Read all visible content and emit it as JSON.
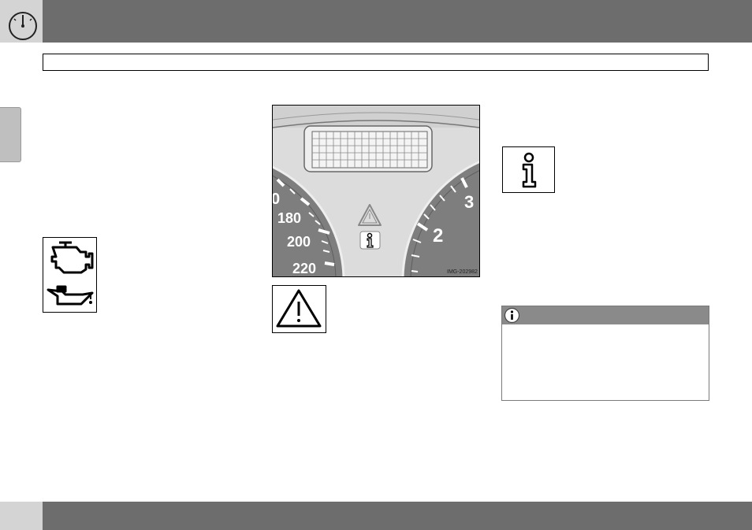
{
  "header": {
    "icon": "speedometer-icon"
  },
  "section": {
    "title": ""
  },
  "icons": {
    "engine": "check-engine-icon",
    "oil": "oil-can-icon",
    "warning": "warning-triangle-icon",
    "info": "information-icon",
    "note": "note-info-icon"
  },
  "cluster": {
    "speed_labels": [
      "0",
      "180",
      "200",
      "220"
    ],
    "rpm_labels": [
      "3",
      "2"
    ],
    "image_code": "IMG-202982"
  },
  "note": {
    "header": ""
  },
  "footer": {
    "page_number": ""
  }
}
